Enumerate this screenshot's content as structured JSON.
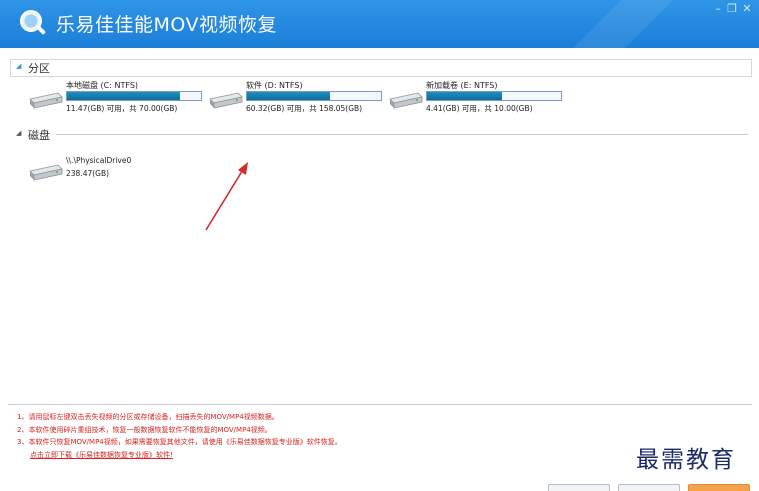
{
  "app": {
    "title": "乐易佳佳能MOV视频恢复",
    "window_controls": {
      "minimize": "–",
      "restore": "❐",
      "close": "✕"
    }
  },
  "sections": {
    "partitions_label": "分区",
    "disks_label": "磁盘"
  },
  "partitions": [
    {
      "name": "本地磁盘 (C: NTFS)",
      "space": "11.47(GB) 可用，共 70.00(GB)",
      "used_fraction": 0.84
    },
    {
      "name": "软件 (D: NTFS)",
      "space": "60.32(GB) 可用，共 158.05(GB)",
      "used_fraction": 0.62
    },
    {
      "name": "新加载卷 (E: NTFS)",
      "space": "4.41(GB) 可用，共 10.00(GB)",
      "used_fraction": 0.56
    }
  ],
  "disks": [
    {
      "name": "\\\\.\\PhysicalDrive0",
      "size": "238.47(GB)"
    }
  ],
  "notes": [
    "1、请用鼠标左键双击丢失视频的分区或存储设备，扫描丢失的MOV/MP4视频数据。",
    "2、本软件使用碎片重组技术，恢复一般数据恢复软件不能恢复的MOV/MP4视频。",
    "3、本软件只恢复MOV/MP4视频，如果需要恢复其他文件，请使用《乐易佳数据恢复专业版》软件恢复。"
  ],
  "download_link": "点击立即下载《乐易佳数据恢复专业版》软件!",
  "watermark": "最需教育",
  "colors": {
    "titlebar": "#1f86dc",
    "capacity_bar": "#1a86b8",
    "notes_text": "#e02020",
    "arrow": "#d42a2a"
  }
}
